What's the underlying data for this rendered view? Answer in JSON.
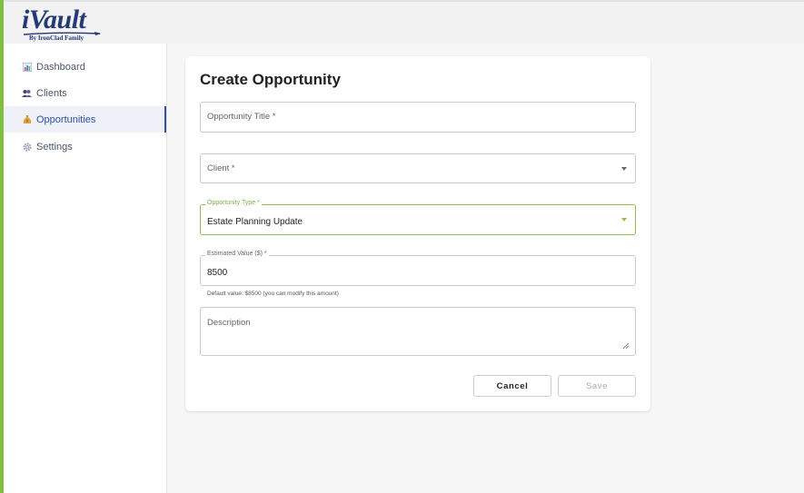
{
  "brand": {
    "logo_text": "iVault",
    "tagline": "By IronClad Family",
    "colors": {
      "primary": "#2d4fb0",
      "focus": "#8cc24a",
      "logo": "#233a7a"
    }
  },
  "sidebar": {
    "items": [
      {
        "label": "Dashboard",
        "icon": "bar-chart-icon",
        "active": false
      },
      {
        "label": "Clients",
        "icon": "people-icon",
        "active": false
      },
      {
        "label": "Opportunities",
        "icon": "money-bag-icon",
        "active": true
      },
      {
        "label": "Settings",
        "icon": "gear-icon",
        "active": false
      }
    ]
  },
  "form": {
    "title": "Create Opportunity",
    "opportunity_title": {
      "placeholder": "Opportunity Title *",
      "value": ""
    },
    "client": {
      "placeholder": "Client *",
      "value": ""
    },
    "opportunity_type": {
      "label": "Opportunity Type *",
      "value": "Estate Planning Update"
    },
    "estimated_value": {
      "label": "Estimated Value ($) *",
      "value": "8500",
      "helper": "Default value: $8500 (you can modify this amount)"
    },
    "description": {
      "placeholder": "Description",
      "value": ""
    },
    "actions": {
      "cancel_label": "Cancel",
      "save_label": "Save"
    }
  }
}
